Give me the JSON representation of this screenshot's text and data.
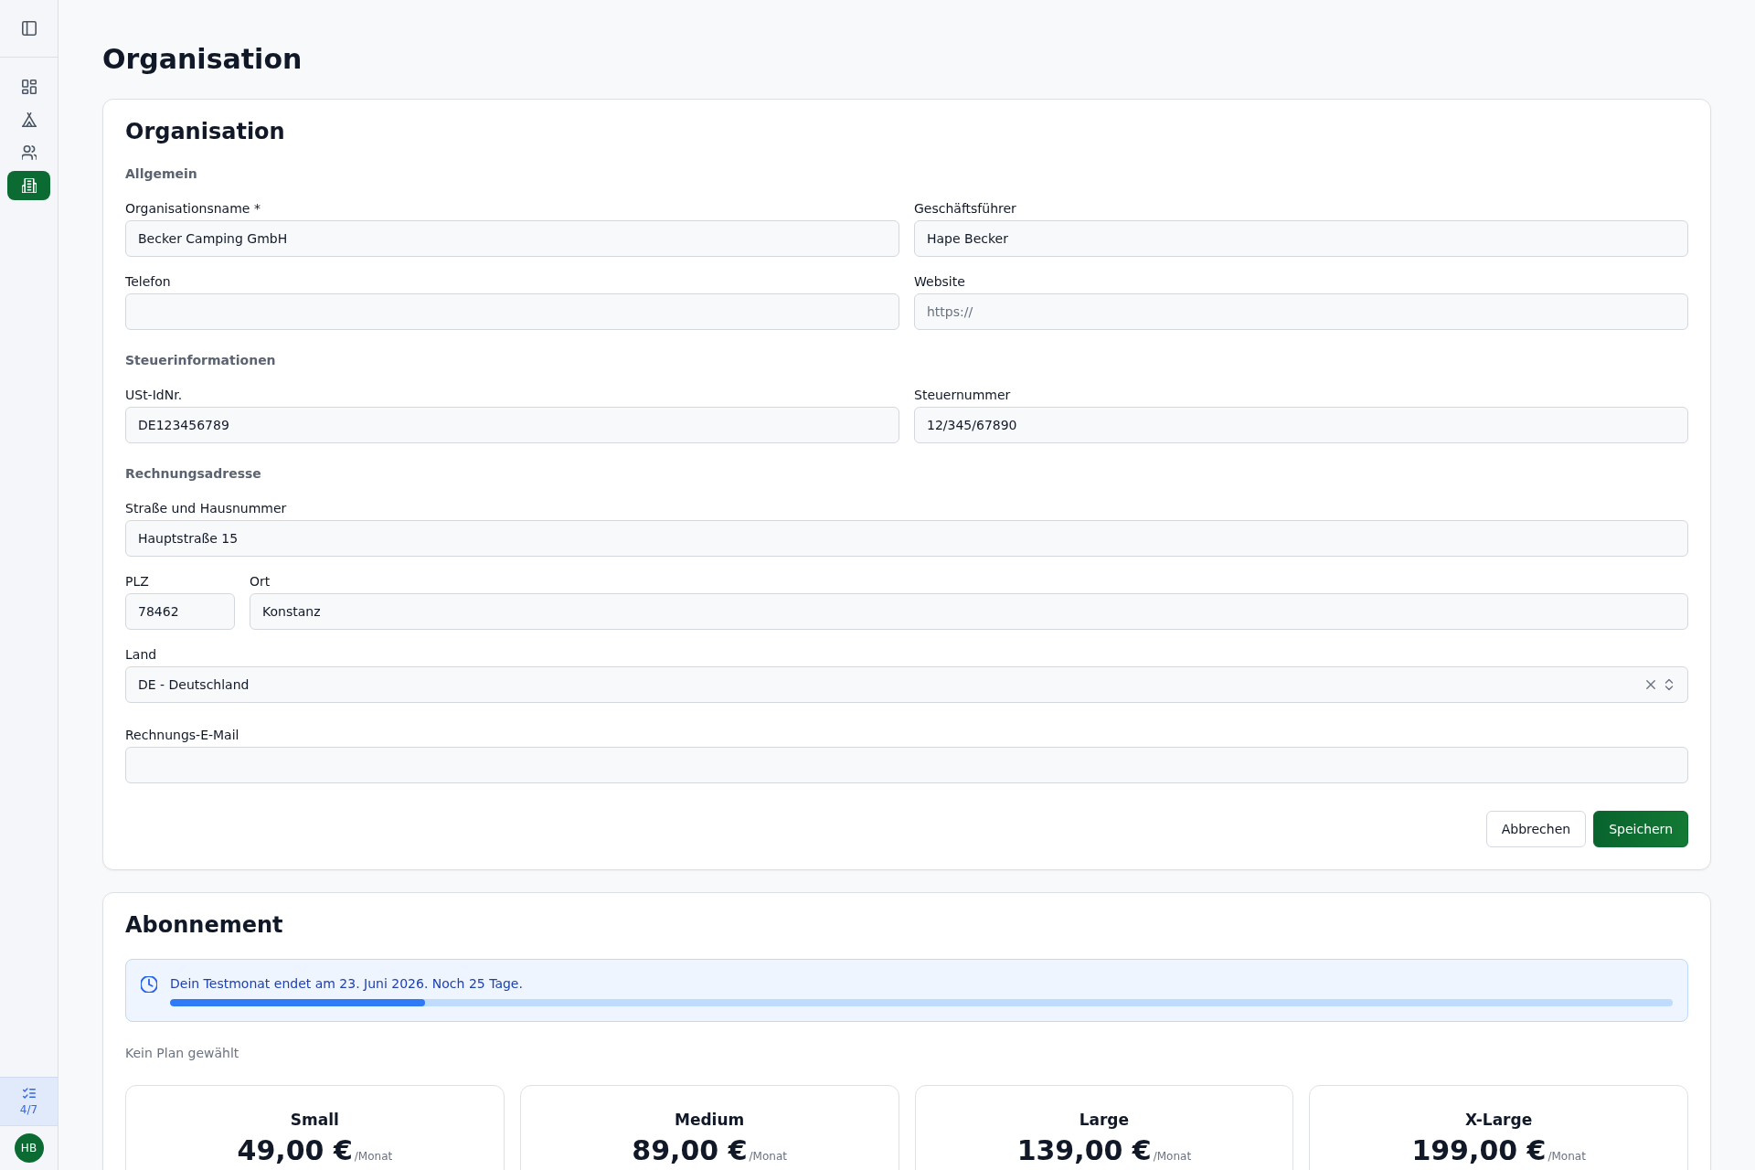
{
  "sidebar": {
    "nav_items": [
      {
        "selected": false
      },
      {
        "selected": false
      },
      {
        "selected": false
      },
      {
        "selected": true
      }
    ],
    "checklist": {
      "progress": "4/7"
    },
    "avatar": {
      "initials": "HB"
    }
  },
  "page_title": "Organisation",
  "organisation_card": {
    "title": "Organisation",
    "sections": [
      {
        "heading": "Allgemein",
        "rows": [
          {
            "kind": "pair",
            "fields": [
              {
                "kind": "text",
                "label": "Organisationsname *",
                "value": "Becker Camping GmbH"
              },
              {
                "kind": "text",
                "label": "Geschäftsführer",
                "value": "Hape Becker"
              }
            ]
          },
          {
            "kind": "pair",
            "fields": [
              {
                "kind": "text",
                "label": "Telefon"
              },
              {
                "kind": "text",
                "label": "Website",
                "placeholder": "https://"
              }
            ]
          }
        ]
      },
      {
        "heading": "Steuerinformationen",
        "rows": [
          {
            "kind": "pair",
            "fields": [
              {
                "kind": "text",
                "label": "USt-IdNr.",
                "value": "DE123456789"
              },
              {
                "kind": "text",
                "label": "Steuernummer",
                "value": "12/345/67890"
              }
            ]
          }
        ]
      },
      {
        "heading": "Rechnungsadresse",
        "rows": [
          {
            "kind": "full",
            "fields": [
              {
                "kind": "text",
                "label": "Straße und Hausnummer",
                "value": "Hauptstraße 15"
              }
            ]
          },
          {
            "kind": "postal",
            "fields": [
              {
                "kind": "text",
                "label": "PLZ",
                "value": "78462"
              },
              {
                "kind": "text",
                "label": "Ort",
                "value": "Konstanz"
              }
            ]
          },
          {
            "kind": "full",
            "fields": [
              {
                "kind": "select",
                "label": "Land",
                "value": "DE - Deutschland"
              }
            ]
          },
          {
            "kind": "full",
            "fields": [
              {
                "kind": "text",
                "label": "Rechnungs-E-Mail"
              }
            ]
          }
        ]
      }
    ],
    "buttons": [
      {
        "kind": "secondary",
        "label": "Abbrechen"
      },
      {
        "kind": "primary",
        "label": "Speichern"
      }
    ]
  },
  "subscription_card": {
    "title": "Abonnement",
    "trial_notice": {
      "text": "Dein Testmonat endet am 23. Juni 2026. Noch 25 Tage.",
      "level": 0.17
    },
    "status": "Kein Plan gewählt",
    "plans": [
      {
        "name": "Small",
        "price": "49,00 €",
        "period": "/Monat"
      },
      {
        "name": "Medium",
        "price": "89,00 €",
        "period": "/Monat"
      },
      {
        "name": "Large",
        "price": "139,00 €",
        "period": "/Monat"
      },
      {
        "name": "X-Large",
        "price": "199,00 €",
        "period": "/Monat"
      }
    ]
  }
}
